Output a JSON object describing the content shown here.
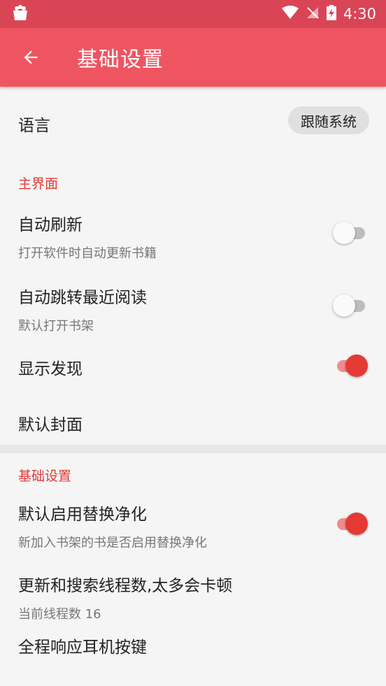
{
  "status_bar": {
    "time": "4:30"
  },
  "app_bar": {
    "title": "基础设置"
  },
  "language": {
    "label": "语言",
    "value": "跟随系统"
  },
  "section_main": {
    "title": "主界面",
    "items": [
      {
        "title": "自动刷新",
        "subtitle": "打开软件时自动更新书籍",
        "checked": false
      },
      {
        "title": "自动跳转最近阅读",
        "subtitle": "默认打开书架",
        "checked": false
      },
      {
        "title": "显示发现",
        "checked": true
      },
      {
        "title": "默认封面"
      }
    ]
  },
  "section_basic": {
    "title": "基础设置",
    "items": [
      {
        "title": "默认启用替换净化",
        "subtitle": "新加入书架的书是否启用替换净化",
        "checked": true
      },
      {
        "title": "更新和搜索线程数,太多会卡顿",
        "subtitle": "当前线程数 16"
      },
      {
        "title": "全程响应耳机按键"
      }
    ]
  },
  "colors": {
    "accent": "#e53935",
    "app_bar": "#ef5561",
    "status_bar": "#d94555"
  }
}
